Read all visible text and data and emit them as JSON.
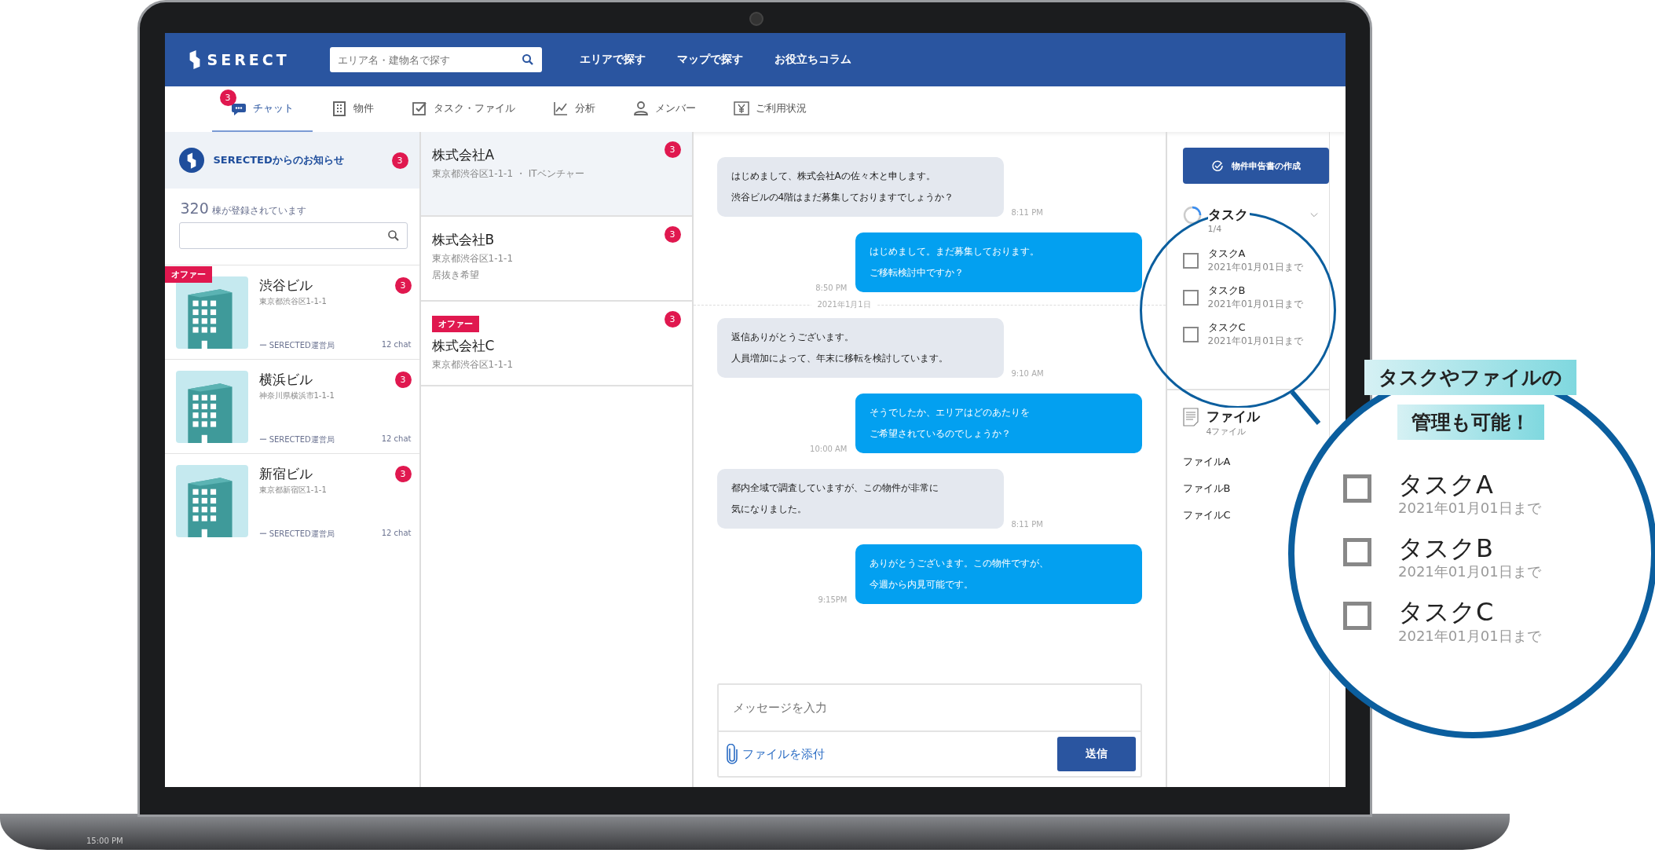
{
  "header": {
    "logo": "SERECT",
    "search": {
      "placeholder": "エリア名・建物名で探す"
    },
    "links": [
      "エリアで探す",
      "マップで探す",
      "お役立ちコラム"
    ]
  },
  "nav_tabs": [
    {
      "label": "チャット",
      "badge": "3",
      "selected": true
    },
    {
      "label": "物件",
      "selected": false
    },
    {
      "label": "タスク・ファイル",
      "selected": false
    },
    {
      "label": "分析",
      "selected": false
    },
    {
      "label": "メンバー",
      "selected": false
    },
    {
      "label": "ご利用状況",
      "selected": false
    }
  ],
  "notice": {
    "title": "SERECTEDからのお知らせ",
    "badge": "3"
  },
  "building_count": {
    "number": "320",
    "label": "棟が登録されています"
  },
  "buildings": [
    {
      "name": "渋谷ビル",
      "address": "東京都渋谷区1-1-1",
      "sender": "ー SERECTED運営局",
      "chats": "12 chat",
      "badge": "3",
      "offer": "オファー"
    },
    {
      "name": "横浜ビル",
      "address": "神奈川県横浜市1-1-1",
      "sender": "ー SERECTED運営局",
      "chats": "12 chat",
      "badge": "3"
    },
    {
      "name": "新宿ビル",
      "address": "東京都新宿区1-1-1",
      "sender": "ー SERECTED運営局",
      "chats": "12 chat",
      "badge": "3"
    }
  ],
  "companies": [
    {
      "name": "株式会社A",
      "details": [
        "東京都渋谷区1-1-1 ・ ITベンチャー"
      ],
      "badge": "3",
      "selected": true
    },
    {
      "name": "株式会社B",
      "details": [
        "東京都渋谷区1-1-1",
        "居抜き希望"
      ],
      "badge": "3",
      "selected": false
    },
    {
      "name": "株式会社C",
      "details": [
        "東京都渋谷区1-1-1"
      ],
      "badge": "3",
      "offer": "オファー",
      "selected": false
    }
  ],
  "chat": [
    {
      "kind": "received",
      "lines": [
        "はじめまして、株式会社Aの佐々木と申します。",
        "渋谷ビルの4階はまだ募集しておりますでしょうか？"
      ],
      "time": "8:11 PM"
    },
    {
      "kind": "sent",
      "lines": [
        "はじめまして。まだ募集しております。",
        "ご移転検討中ですか？"
      ],
      "time": "8:50 PM"
    },
    {
      "kind": "divider",
      "text": "2021年1月1日"
    },
    {
      "kind": "received",
      "lines": [
        "返信ありがとうございます。",
        "人員増加によって、年末に移転を検討しています。"
      ],
      "time": "9:10 AM"
    },
    {
      "kind": "sent",
      "lines": [
        "そうでしたか、エリアはどのあたりを",
        "ご希望されているのでしょうか？"
      ],
      "time": "10:00 AM"
    },
    {
      "kind": "received",
      "lines": [
        "都内全域で調査していますが、この物件が非常に",
        "気になりました。"
      ],
      "time": "8:11 PM"
    },
    {
      "kind": "sent",
      "lines": [
        "ありがとうございます。この物件ですが、",
        "今週から内見可能です。"
      ],
      "time": "9:15PM"
    }
  ],
  "composer": {
    "placeholder": "メッセージを入力",
    "attach": "ファイルを添付",
    "send": "送信"
  },
  "report_button": "物件申告書の作成",
  "tasks_panel": {
    "title": "タスク",
    "count": "1/4",
    "level": 0.25,
    "tasks": [
      {
        "name": "タスクA",
        "due": "2021年01月01日まで",
        "checked": false
      },
      {
        "name": "タスクB",
        "due": "2021年01月01日まで",
        "checked": false
      },
      {
        "name": "タスクC",
        "due": "2021年01月01日まで",
        "checked": false
      }
    ]
  },
  "files_panel": {
    "title": "ファイル",
    "count": "4ファイル",
    "files": [
      "ファイルA",
      "ファイルB",
      "ファイルC"
    ]
  },
  "callout": {
    "lines": [
      "タスクやファイルの",
      "管理も可能！"
    ],
    "tasks": [
      {
        "name": "タスクA",
        "due": "2021年01月01日まで",
        "checked": false
      },
      {
        "name": "タスクB",
        "due": "2021年01月01日まで",
        "checked": false
      },
      {
        "name": "タスクC",
        "due": "2021年01月01日まで",
        "checked": false
      }
    ]
  },
  "laptop": {
    "clock": "15:00 PM"
  }
}
